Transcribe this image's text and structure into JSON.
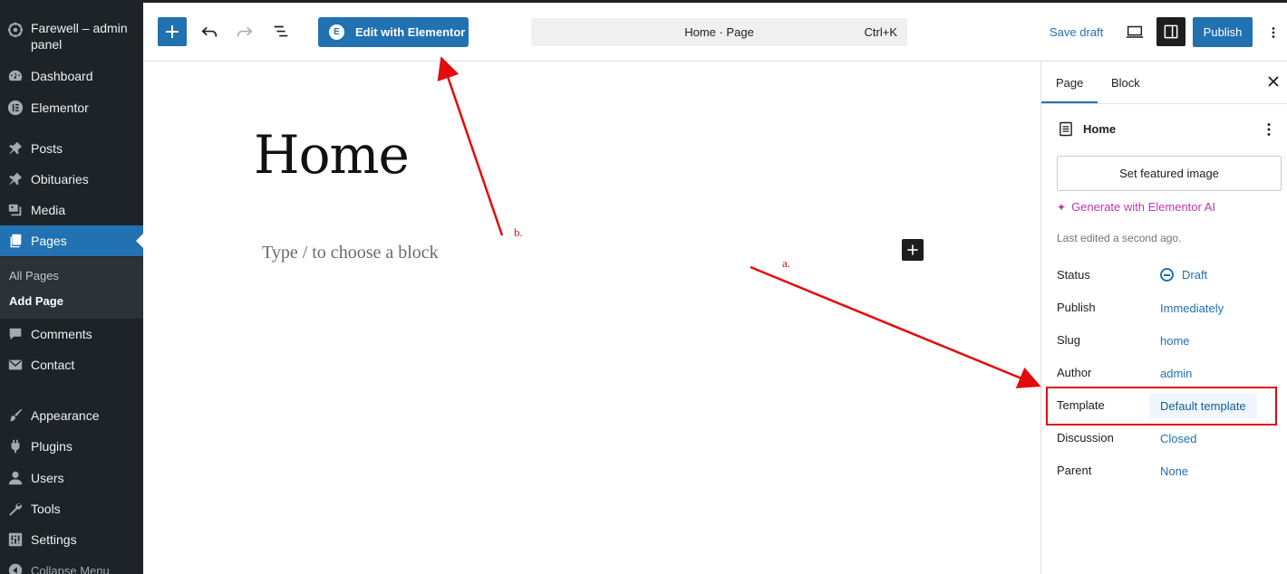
{
  "admin_menu": {
    "site_name": "Farewell – admin panel",
    "items": [
      {
        "label": "Dashboard",
        "icon": "dashboard-icon"
      },
      {
        "label": "Elementor",
        "icon": "elementor-icon"
      },
      {
        "label": "Posts",
        "icon": "pin-icon"
      },
      {
        "label": "Obituaries",
        "icon": "pin-icon"
      },
      {
        "label": "Media",
        "icon": "media-icon"
      },
      {
        "label": "Pages",
        "icon": "pages-icon",
        "active": true
      },
      {
        "label": "Comments",
        "icon": "comment-icon"
      },
      {
        "label": "Contact",
        "icon": "mail-icon"
      },
      {
        "label": "Appearance",
        "icon": "brush-icon"
      },
      {
        "label": "Plugins",
        "icon": "plugin-icon"
      },
      {
        "label": "Users",
        "icon": "user-icon"
      },
      {
        "label": "Tools",
        "icon": "wrench-icon"
      },
      {
        "label": "Settings",
        "icon": "settings-icon"
      }
    ],
    "pages_submenu": [
      "All Pages",
      "Add Page"
    ],
    "collapse_label": "Collapse Menu"
  },
  "toolbar": {
    "edit_elementor_label": "Edit with Elementor",
    "command_title": "Home · Page",
    "command_shortcut": "Ctrl+K",
    "save_draft_label": "Save draft",
    "publish_label": "Publish"
  },
  "canvas": {
    "title": "Home",
    "placeholder": "Type / to choose a block"
  },
  "sidebar": {
    "tabs": [
      "Page",
      "Block"
    ],
    "doc_title": "Home",
    "featured_image_label": "Set featured image",
    "ai_label": "Generate with Elementor AI",
    "last_edited": "Last edited a second ago.",
    "rows": [
      {
        "label": "Status",
        "value": "Draft"
      },
      {
        "label": "Publish",
        "value": "Immediately"
      },
      {
        "label": "Slug",
        "value": "home"
      },
      {
        "label": "Author",
        "value": "admin"
      },
      {
        "label": "Template",
        "value": "Default template"
      },
      {
        "label": "Discussion",
        "value": "Closed"
      },
      {
        "label": "Parent",
        "value": "None"
      }
    ]
  },
  "annotations": {
    "a_label": "a.",
    "b_label": "b.",
    "color": "#e30b0b"
  },
  "colors": {
    "admin_bg": "#1d2327",
    "accent": "#2271b1",
    "ai": "#c036b0"
  }
}
